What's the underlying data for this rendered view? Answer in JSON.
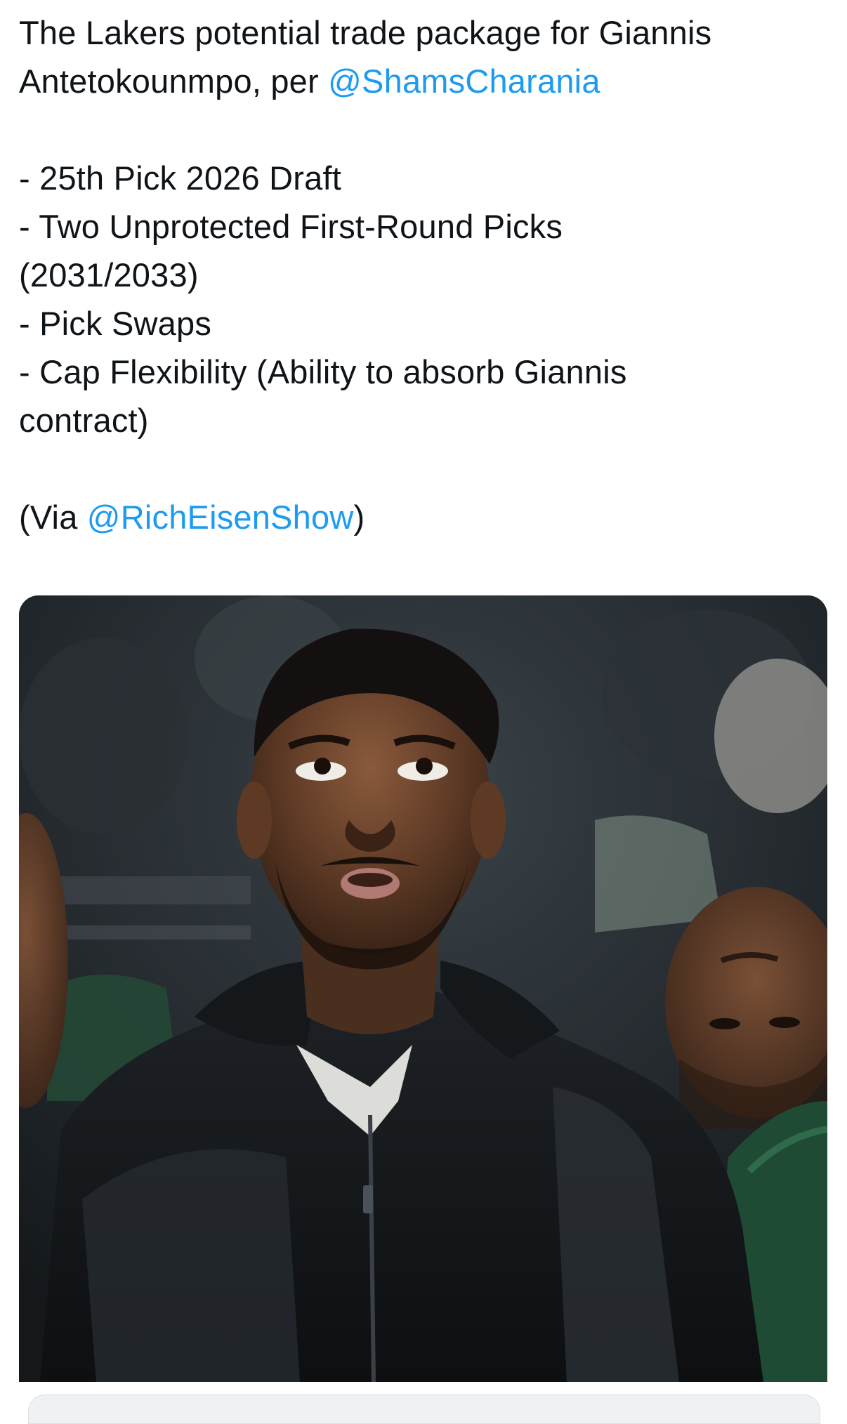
{
  "tweet": {
    "line1": "The Lakers potential trade package for Giannis",
    "line2_prefix": "Antetokounmpo, per ",
    "mention1": "@ShamsCharania",
    "bullet1": "- 25th Pick 2026 Draft",
    "bullet2a": "- Two Unprotected First-Round Picks",
    "bullet2b": "(2031/2033)",
    "bullet3": "- Pick Swaps",
    "bullet4a": "- Cap Flexibility (Ability to absorb Giannis",
    "bullet4b": "contract)",
    "via_prefix": "(Via ",
    "mention2": "@RichEisenShow",
    "via_suffix": ")"
  },
  "colors": {
    "text": "#0f1419",
    "mention": "#1d9bf0",
    "background": "#ffffff"
  }
}
